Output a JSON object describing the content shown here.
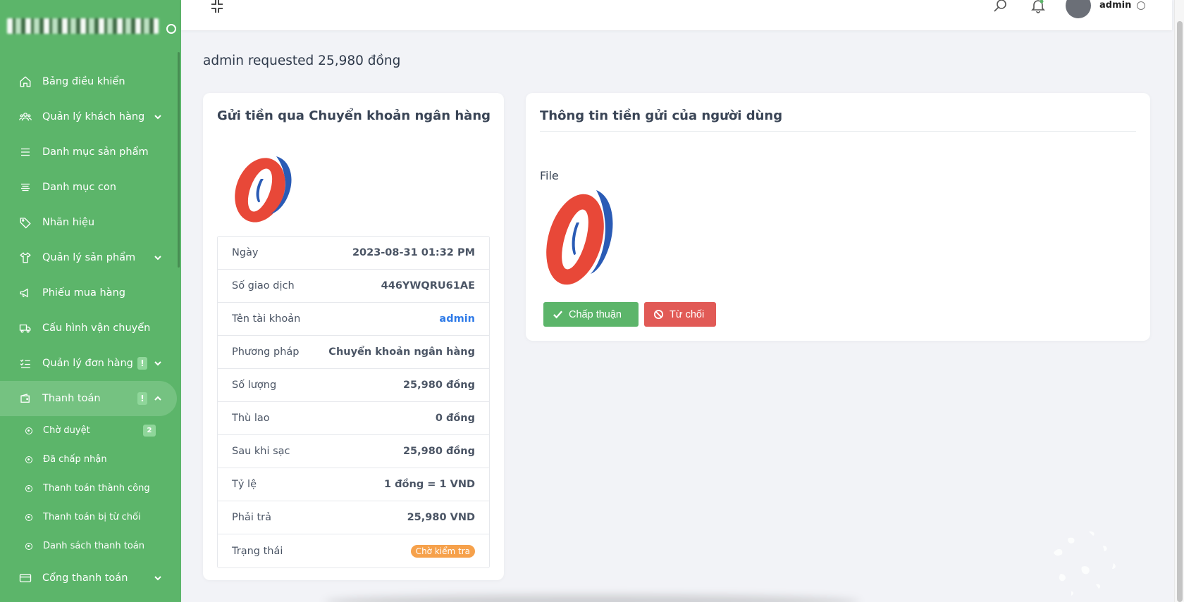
{
  "sidebar": {
    "items": [
      {
        "label": "Bảng điều khiển",
        "icon": "home-icon"
      },
      {
        "label": "Quản lý khách hàng",
        "icon": "users-icon",
        "chevron": "down"
      },
      {
        "label": "Danh mục sản phẩm",
        "icon": "menu-icon"
      },
      {
        "label": "Danh mục con",
        "icon": "align-icon"
      },
      {
        "label": "Nhãn hiệu",
        "icon": "tag-icon"
      },
      {
        "label": "Quản lý sản phẩm",
        "icon": "shirt-icon",
        "chevron": "down"
      },
      {
        "label": "Phiếu mua hàng",
        "icon": "megaphone-icon"
      },
      {
        "label": "Cấu hình vận chuyển",
        "icon": "truck-icon"
      },
      {
        "label": "Quản lý đơn hàng",
        "icon": "list-check-icon",
        "chevron": "down",
        "badge": "!"
      },
      {
        "label": "Thanh toán",
        "icon": "wallet-icon",
        "chevron": "up",
        "badge": "!",
        "active": true
      }
    ],
    "sub_items": [
      {
        "label": "Chờ duyệt",
        "count": "2"
      },
      {
        "label": "Đã chấp nhận"
      },
      {
        "label": "Thanh toán thành công"
      },
      {
        "label": "Thanh toán bị từ chối"
      },
      {
        "label": "Danh sách thanh toán"
      }
    ],
    "last_item": {
      "label": "Cổng thanh toán",
      "icon": "card-icon",
      "chevron": "down"
    }
  },
  "topbar": {
    "username": "admin"
  },
  "page": {
    "title": "admin requested 25,980 đồng"
  },
  "left_card": {
    "title": "Gửi tiền qua Chuyển khoản ngân hàng",
    "rows": [
      {
        "label": "Ngày",
        "value": "2023-08-31 01:32 PM"
      },
      {
        "label": "Số giao dịch",
        "value": "446YWQRU61AE"
      },
      {
        "label": "Tên tài khoản",
        "value": "admin"
      },
      {
        "label": "Phương pháp",
        "value": "Chuyển khoản ngân hàng"
      },
      {
        "label": "Số lượng",
        "value": "25,980 đồng"
      },
      {
        "label": "Thù lao",
        "value": "0 đồng"
      },
      {
        "label": "Sau khi sạc",
        "value": "25,980 đồng"
      },
      {
        "label": "Tỷ lệ",
        "value": "1 đồng = 1 VND"
      },
      {
        "label": "Phải trả",
        "value": "25,980 VND"
      },
      {
        "label": "Trạng thái",
        "value": "Chờ kiểm tra"
      }
    ]
  },
  "right_card": {
    "title": "Thông tin tiền gửi của người dùng",
    "file_label": "File",
    "approve_label": "Chấp thuận",
    "reject_label": "Từ chối"
  },
  "colors": {
    "sidebar": "#5cb56a",
    "approve": "#5cb56a",
    "reject": "#e15a56",
    "status_badge": "#f6a14b",
    "link": "#2f7be8"
  }
}
